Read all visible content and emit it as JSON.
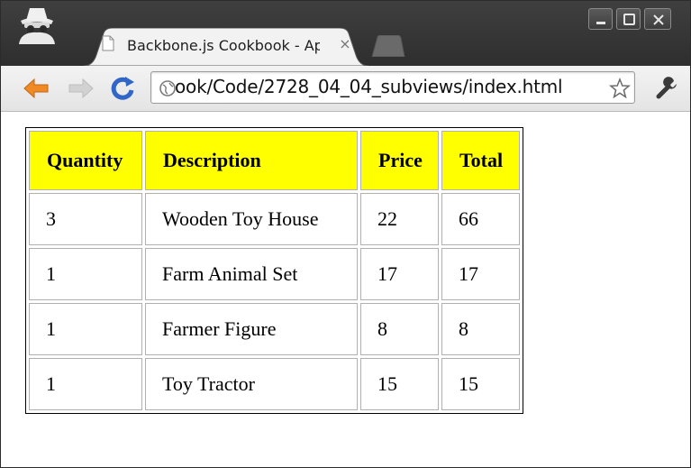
{
  "browser": {
    "tab_title": "Backbone.js Cookbook - Ap",
    "url": "ook/Code/2728_04_04_subviews/index.html",
    "colors": {
      "header_bg": "#ffff00",
      "chrome_dark": "#333333",
      "reload_blue": "#2f66c8",
      "back_orange": "#f08a24"
    }
  },
  "table": {
    "headers": [
      "Quantity",
      "Description",
      "Price",
      "Total"
    ],
    "rows": [
      [
        "3",
        "Wooden Toy House",
        "22",
        "66"
      ],
      [
        "1",
        "Farm Animal Set",
        "17",
        "17"
      ],
      [
        "1",
        "Farmer Figure",
        "8",
        "8"
      ],
      [
        "1",
        "Toy Tractor",
        "15",
        "15"
      ]
    ]
  }
}
